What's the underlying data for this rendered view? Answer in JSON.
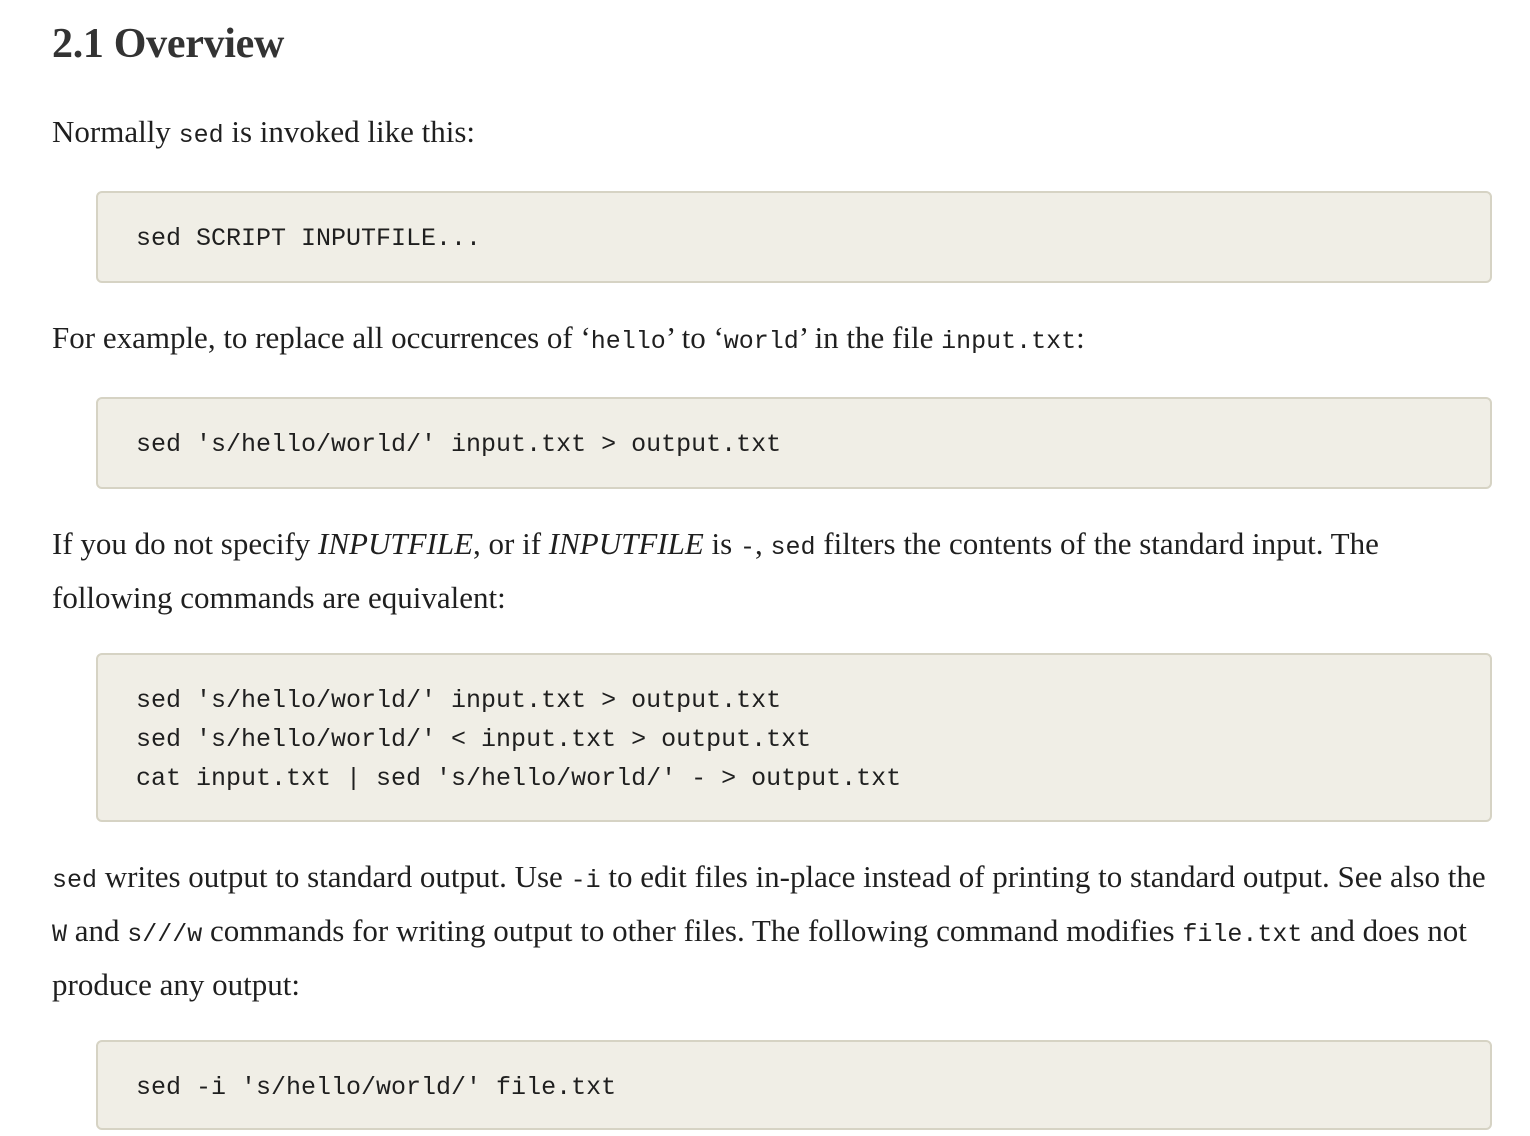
{
  "section": {
    "title": "2.1 Overview"
  },
  "p1": {
    "t1": "Normally ",
    "c1": "sed",
    "t2": " is invoked like this:"
  },
  "code1": {
    "lines": [
      "sed SCRIPT INPUTFILE..."
    ]
  },
  "p2": {
    "t1": "For example, to replace all occurrences of ‘",
    "c1": "hello",
    "t2": "’ to ‘",
    "c2": "world",
    "t3": "’ in the file ",
    "c3": "input.txt",
    "t4": ":"
  },
  "code2": {
    "lines": [
      "sed 's/hello/world/' input.txt > output.txt"
    ]
  },
  "p3": {
    "t1": "If you do not specify ",
    "e1": "INPUTFILE",
    "t2": ", or if ",
    "e2": "INPUTFILE",
    "t3": " is ",
    "c1": "-",
    "t4": ", ",
    "c2": "sed",
    "t5": " filters the contents of the standard input. The following commands are equivalent:"
  },
  "code3": {
    "lines": [
      "sed 's/hello/world/' input.txt > output.txt",
      "sed 's/hello/world/' < input.txt > output.txt",
      "cat input.txt | sed 's/hello/world/' - > output.txt"
    ]
  },
  "p4": {
    "c1": "sed",
    "t1": " writes output to standard output. Use ",
    "c2": "-i",
    "t2": " to edit files in-place instead of printing to standard output. See also the ",
    "c3": "W",
    "t3": " and ",
    "c4": "s///w",
    "t4": " commands for writing output to other files. The following command modifies ",
    "c5": "file.txt",
    "t5": " and does not produce any output:"
  },
  "code4": {
    "lines": [
      "sed -i 's/hello/world/' file.txt"
    ]
  },
  "colors": {
    "code_background": "#f0eee6",
    "code_border": "#d6d3c4",
    "heading": "#333333",
    "text": "#1f1f1f"
  }
}
